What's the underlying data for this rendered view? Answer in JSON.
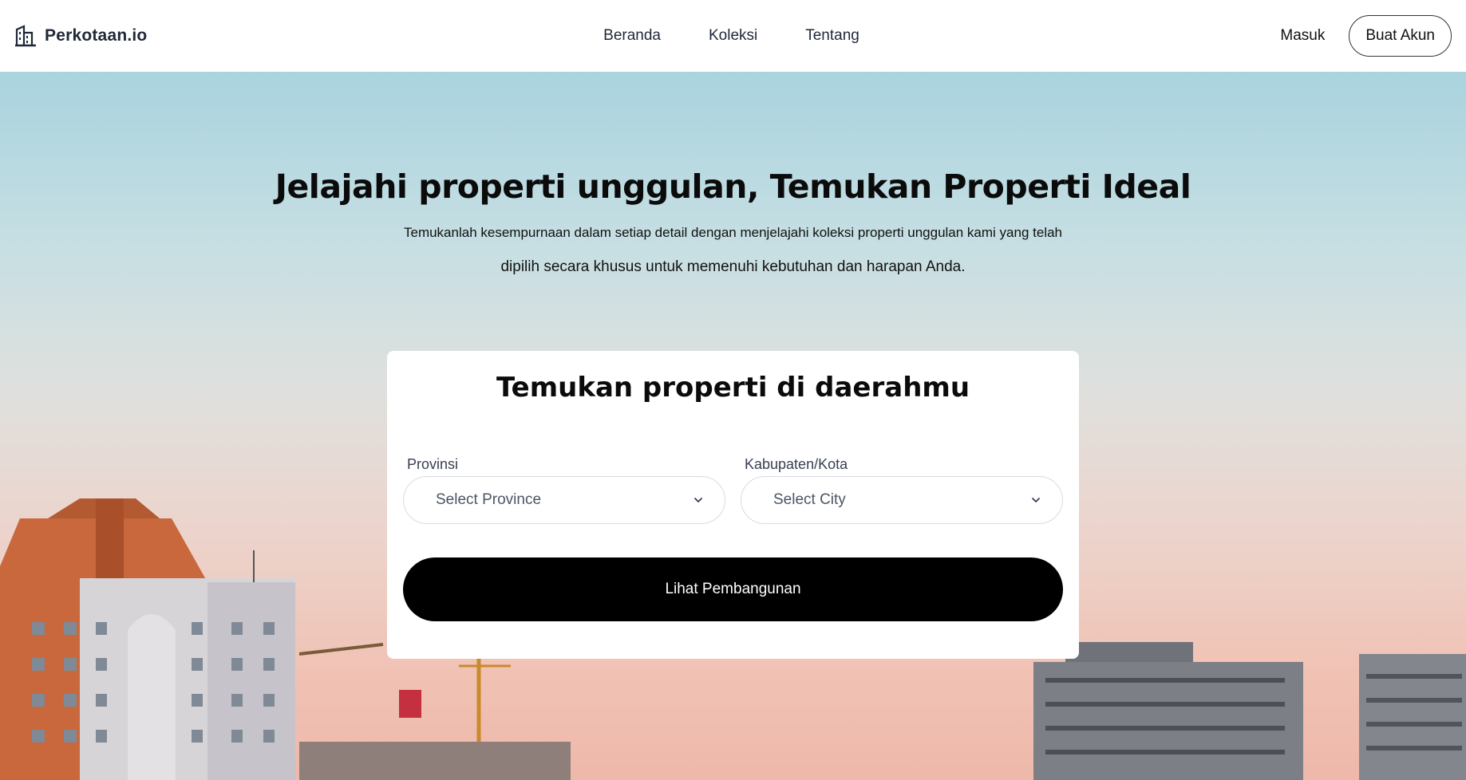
{
  "brand": {
    "name": "Perkotaan.io",
    "icon": "building-icon"
  },
  "nav": {
    "items": [
      "Beranda",
      "Koleksi",
      "Tentang"
    ]
  },
  "auth": {
    "login_label": "Masuk",
    "signup_label": "Buat Akun"
  },
  "hero": {
    "title": "Jelajahi properti unggulan, Temukan Properti Ideal",
    "subtitle_line1": "Temukanlah kesempurnaan dalam setiap detail dengan menjelajahi koleksi properti unggulan kami yang telah",
    "subtitle_line2": "dipilih secara khusus untuk memenuhi kebutuhan dan harapan Anda."
  },
  "search_card": {
    "title": "Temukan properti di daerahmu",
    "province": {
      "label": "Provinsi",
      "value": "Select Province",
      "icon": "chevron-down-icon"
    },
    "city": {
      "label": "Kabupaten/Kota",
      "value": "Select City",
      "icon": "chevron-down-icon"
    },
    "submit_label": "Lihat Pembangunan"
  },
  "colors": {
    "primary_button": "#000000",
    "sky_top": "#a9d3de",
    "sky_bottom": "#eeb8aa",
    "text": "#111111"
  }
}
